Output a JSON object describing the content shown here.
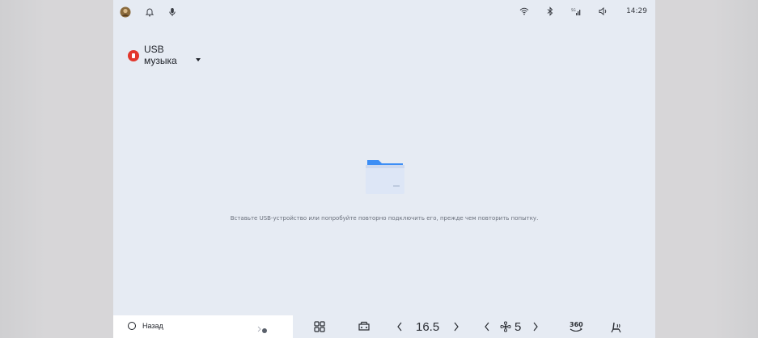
{
  "status_bar": {
    "time": "14:29",
    "icons_left": [
      "avatar-icon",
      "bell-icon",
      "microphone-icon"
    ],
    "icons_right": [
      "wifi-icon",
      "bluetooth-icon",
      "signal-icon",
      "volume-icon"
    ]
  },
  "source": {
    "label": "USB музыка",
    "icon": "usb-music-icon"
  },
  "empty_state": {
    "icon": "folder-icon",
    "message": "Вставьте USB-устройство или попробуйте повторно подключить его, прежде чем повторить попытку."
  },
  "bottom_bar": {
    "back_label": "Назад",
    "temperature": "16.5",
    "fan_speed": "5",
    "camera_label": "360",
    "icons": [
      "apps-icon",
      "car-icon",
      "chevron-left-icon",
      "chevron-right-icon",
      "fan-icon",
      "360-camera-icon",
      "seat-heat-icon"
    ]
  },
  "colors": {
    "screen_bg": "#e6ebf3",
    "accent_red": "#e2372c",
    "folder_blue": "#3d8ef5"
  }
}
